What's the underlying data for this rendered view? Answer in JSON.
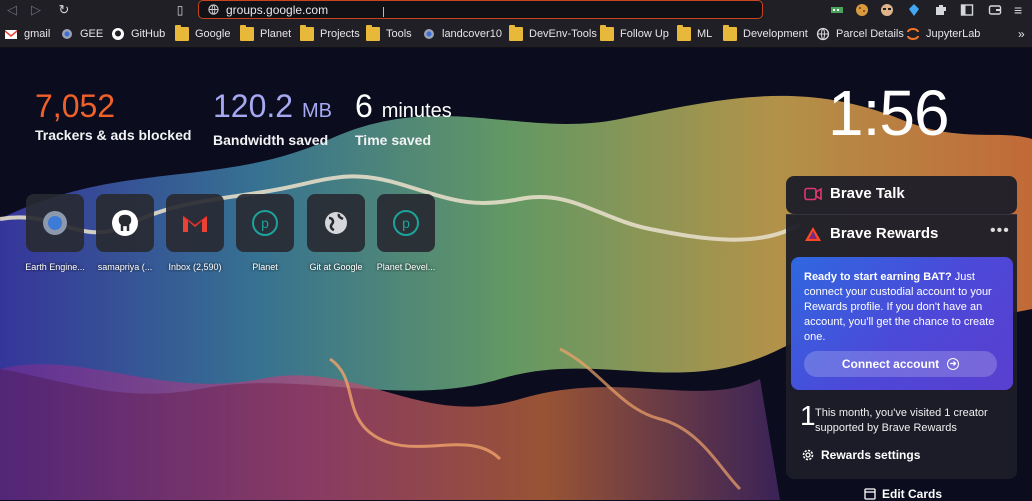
{
  "toolbar": {
    "url": "groups.google.com"
  },
  "bookmarks": [
    {
      "label": "gmail",
      "icon": "gmail-icon"
    },
    {
      "label": "GEE",
      "icon": "gear-icon"
    },
    {
      "label": "GitHub",
      "icon": "github-icon"
    },
    {
      "label": "Google",
      "icon": "folder-icon"
    },
    {
      "label": "Planet",
      "icon": "folder-icon"
    },
    {
      "label": "Projects",
      "icon": "folder-icon"
    },
    {
      "label": "Tools",
      "icon": "folder-icon"
    },
    {
      "label": "landcover10",
      "icon": "gear-icon"
    },
    {
      "label": "DevEnv-Tools",
      "icon": "folder-icon"
    },
    {
      "label": "Follow Up",
      "icon": "folder-icon"
    },
    {
      "label": "ML",
      "icon": "folder-icon"
    },
    {
      "label": "Development",
      "icon": "folder-icon"
    },
    {
      "label": "Parcel Details",
      "icon": "globe-icon"
    },
    {
      "label": "JupyterLab",
      "icon": "jupyter-icon"
    }
  ],
  "stats": {
    "trackers": {
      "value": "7,052",
      "label": "Trackers & ads blocked",
      "color": "#f0602a"
    },
    "bandwidth": {
      "value": "120.2",
      "unit": "MB",
      "label": "Bandwidth saved",
      "color": "#a6a9f2"
    },
    "time": {
      "value": "6",
      "unit": "minutes",
      "label": "Time saved",
      "color": "#ffffff"
    }
  },
  "clock": "1:56",
  "top_sites": [
    {
      "name": "Earth Engine...",
      "icon": "earth-engine-icon"
    },
    {
      "name": "samapriya (...",
      "icon": "github-icon"
    },
    {
      "name": "Inbox (2,590)",
      "icon": "gmail-icon"
    },
    {
      "name": "Planet",
      "icon": "planet-icon"
    },
    {
      "name": "Git at Google",
      "icon": "globe-icon"
    },
    {
      "name": "Planet Devel...",
      "icon": "planet-icon"
    }
  ],
  "brave_talk": {
    "title": "Brave Talk"
  },
  "brave_rewards": {
    "title": "Brave Rewards",
    "promo_bold": "Ready to start earning BAT?",
    "promo_text": " Just connect your custodial account to your Rewards profile. If you don't have an account, you'll get the chance to create one.",
    "connect_label": "Connect account",
    "visited_count": "1",
    "visited_text": "This month, you've visited 1 creator supported by Brave Rewards",
    "settings_label": "Rewards settings"
  },
  "edit_cards_label": "Edit Cards"
}
